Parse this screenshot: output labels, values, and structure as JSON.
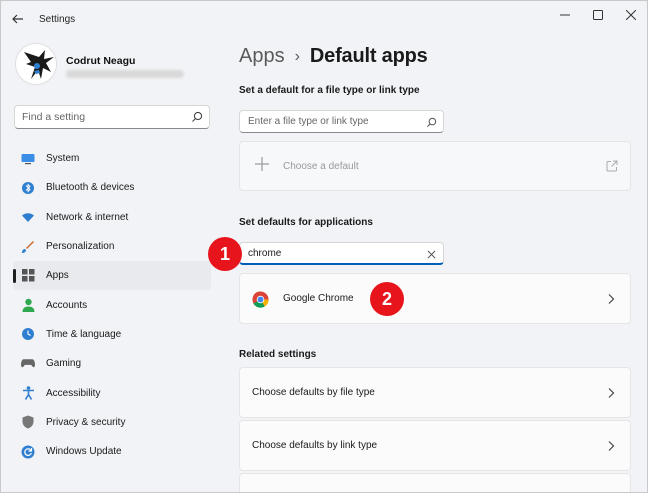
{
  "window": {
    "title": "Settings"
  },
  "profile": {
    "name": "Codrut Neagu"
  },
  "sidebar": {
    "search_placeholder": "Find a setting",
    "items": [
      {
        "label": "System",
        "icon": "monitor-icon",
        "active": false
      },
      {
        "label": "Bluetooth & devices",
        "icon": "bluetooth-icon",
        "active": false
      },
      {
        "label": "Network & internet",
        "icon": "wifi-icon",
        "active": false
      },
      {
        "label": "Personalization",
        "icon": "brush-icon",
        "active": false
      },
      {
        "label": "Apps",
        "icon": "apps-icon",
        "active": true
      },
      {
        "label": "Accounts",
        "icon": "person-icon",
        "active": false
      },
      {
        "label": "Time & language",
        "icon": "globe-clock-icon",
        "active": false
      },
      {
        "label": "Gaming",
        "icon": "gamepad-icon",
        "active": false
      },
      {
        "label": "Accessibility",
        "icon": "accessibility-icon",
        "active": false
      },
      {
        "label": "Privacy & security",
        "icon": "shield-icon",
        "active": false
      },
      {
        "label": "Windows Update",
        "icon": "update-icon",
        "active": false
      }
    ]
  },
  "main": {
    "breadcrumb": {
      "parent": "Apps",
      "separator": "›",
      "current": "Default apps"
    },
    "file_type_section": {
      "label": "Set a default for a file type or link type",
      "placeholder": "Enter a file type or link type",
      "choose_default_label": "Choose a default"
    },
    "apps_section": {
      "label": "Set defaults for applications",
      "search_value": "chrome",
      "result_app": "Google Chrome"
    },
    "related_section": {
      "label": "Related settings",
      "items": [
        "Choose defaults by file type",
        "Choose defaults by link type"
      ]
    }
  },
  "annotations": {
    "badge_1": "1",
    "badge_2": "2"
  },
  "colors": {
    "accent": "#005fb8",
    "badge": "#e8141b",
    "background": "#f1f3f6"
  }
}
